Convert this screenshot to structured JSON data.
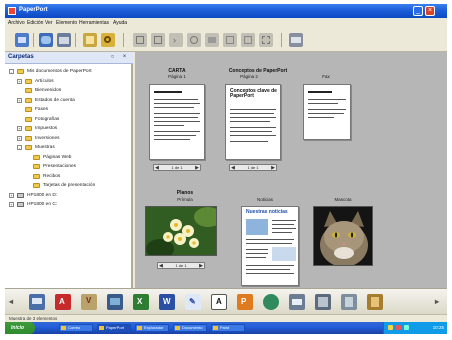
{
  "window": {
    "title": "PaperPort"
  },
  "menu": [
    "Archivo",
    "Edición",
    "Ver",
    "Elemento",
    "Herramientas",
    "Ayuda"
  ],
  "toolbar": {
    "icons": [
      "scan-icon",
      "get-photo-icon",
      "folder-manager-icon",
      "view-mode-icon",
      "search-icon",
      "rotate-icon",
      "copy-icon",
      "move-icon",
      "undo-icon",
      "properties-icon",
      "stack-icon",
      "unstack-icon",
      "grid-icon",
      "layout-icon"
    ]
  },
  "folders": {
    "title": "Carpetas",
    "tree": [
      {
        "label": "Mis documentos de PaperPort",
        "level": 0,
        "expander": "-",
        "type": "folder"
      },
      {
        "label": "Artículos",
        "level": 1,
        "expander": "+",
        "type": "folder"
      },
      {
        "label": "Bienvenidos",
        "level": 1,
        "expander": "",
        "type": "folder"
      },
      {
        "label": "Estados de cuenta",
        "level": 1,
        "expander": "+",
        "type": "folder"
      },
      {
        "label": "Faxes",
        "level": 1,
        "expander": "",
        "type": "folder"
      },
      {
        "label": "Fotografías",
        "level": 1,
        "expander": "",
        "type": "folder"
      },
      {
        "label": "Impuestos",
        "level": 1,
        "expander": "+",
        "type": "folder"
      },
      {
        "label": "Inversiones",
        "level": 1,
        "expander": "+",
        "type": "folder"
      },
      {
        "label": "Muestras",
        "level": 1,
        "expander": "-",
        "type": "folder"
      },
      {
        "label": "Páginas Web",
        "level": 2,
        "expander": "",
        "type": "folder"
      },
      {
        "label": "Presentaciones",
        "level": 2,
        "expander": "",
        "type": "folder"
      },
      {
        "label": "Recibos",
        "level": 2,
        "expander": "",
        "type": "folder"
      },
      {
        "label": "Tarjetas de presentación",
        "level": 2,
        "expander": "",
        "type": "folder"
      },
      {
        "label": "HP1800 en D:",
        "level": 0,
        "expander": "+",
        "type": "drive"
      },
      {
        "label": "HP1800 en C:",
        "level": 0,
        "expander": "+",
        "type": "drive"
      }
    ]
  },
  "content": {
    "top_group_labels": [
      "CARTA",
      "Conceptos de PaperPort",
      "Fax"
    ],
    "top_page_labels": [
      "Página 1",
      "Página 2"
    ],
    "bottom_group_label": "Planos",
    "bottom_labels": [
      "Prímula",
      "Noticias",
      "Mascota"
    ],
    "pagers": [
      "1 de 1",
      "1 de 1",
      "1 de 1"
    ],
    "doc_headline": "Conceptos clave de PaperPort",
    "newsletter_headline": "Nuestras noticias"
  },
  "sendbar": {
    "icons": [
      "scroll-left-icon",
      "printer-icon",
      "pdf-icon",
      "paint-icon",
      "photo-editor-icon",
      "excel-icon",
      "word-icon",
      "notepad-icon",
      "font-icon",
      "powerpoint-icon",
      "internet-icon",
      "email-icon",
      "fax-icon",
      "recycle-icon",
      "archive-icon",
      "scroll-right-icon"
    ]
  },
  "statusbar": {
    "text": "Muestra de 3 elementos"
  },
  "taskbar": {
    "start": "Inicio",
    "tasks": [
      "Correo",
      "PaperPort",
      "Explorador",
      "Documento",
      "Paint"
    ],
    "clock": "10:25"
  },
  "colors": {
    "titlebar": "#1d5fd8",
    "content_bg": "#b6b6b6",
    "taskbar": "#245edb",
    "tray": "#0f9be8"
  }
}
